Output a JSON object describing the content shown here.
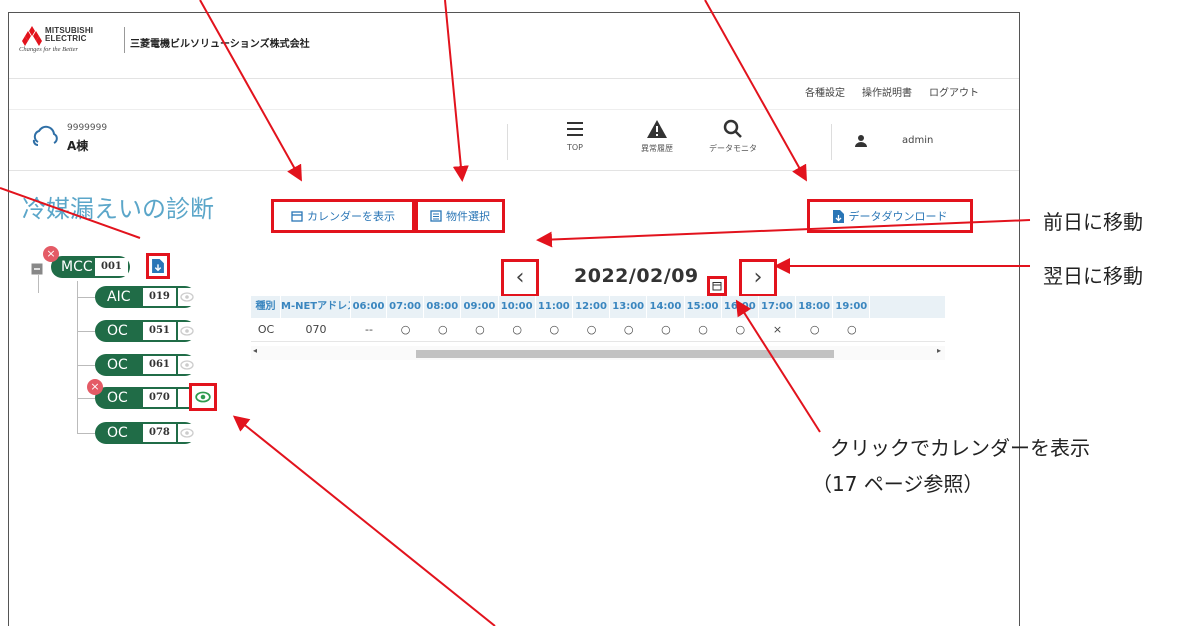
{
  "header": {
    "logo_line1": "MITSUBISHI",
    "logo_line2": "ELECTRIC",
    "logo_tagline": "Changes for the Better",
    "company_name": "三菱電機ビルソリューションズ株式会社"
  },
  "util_links": [
    "各種設定",
    "操作説明書",
    "ログアウト"
  ],
  "building": {
    "number": "9999999",
    "name": "A棟"
  },
  "nav": [
    {
      "label": "TOP",
      "icon": "menu-icon"
    },
    {
      "label": "異常履歴",
      "icon": "warning-icon"
    },
    {
      "label": "データモニタ",
      "icon": "search-icon"
    }
  ],
  "user": {
    "name": "admin"
  },
  "page_title": "冷媒漏えいの診断",
  "buttons": {
    "calendar": "カレンダーを表示",
    "property": "物件選択",
    "download": "データダウンロード"
  },
  "tree": {
    "root": {
      "type": "MCC",
      "address": "001"
    },
    "children": [
      {
        "type": "AIC",
        "address": "019"
      },
      {
        "type": "OC",
        "address": "051"
      },
      {
        "type": "OC",
        "address": "061"
      },
      {
        "type": "OC",
        "address": "070"
      },
      {
        "type": "OC",
        "address": "078"
      }
    ]
  },
  "date": "2022/02/09",
  "table": {
    "headers": [
      "種別",
      "M-NETアドレス",
      "06:00",
      "07:00",
      "08:00",
      "09:00",
      "10:00",
      "11:00",
      "12:00",
      "13:00",
      "14:00",
      "15:00",
      "16:00",
      "17:00",
      "18:00",
      "19:00"
    ],
    "row": [
      "OC",
      "070",
      "--",
      "○",
      "○",
      "○",
      "○",
      "○",
      "○",
      "○",
      "○",
      "○",
      "○",
      "×",
      "○",
      "○"
    ]
  },
  "callouts": {
    "prev_day": "前日に移動",
    "next_day": "翌日に移動",
    "calendar_click": "クリックでカレンダーを表示",
    "calendar_page": "（17 ページ参照）"
  },
  "colors": {
    "accent_red": "#e2131d",
    "unit_green": "#206c47",
    "title_blue": "#5ba6c9",
    "link_blue": "#2a76b6"
  }
}
